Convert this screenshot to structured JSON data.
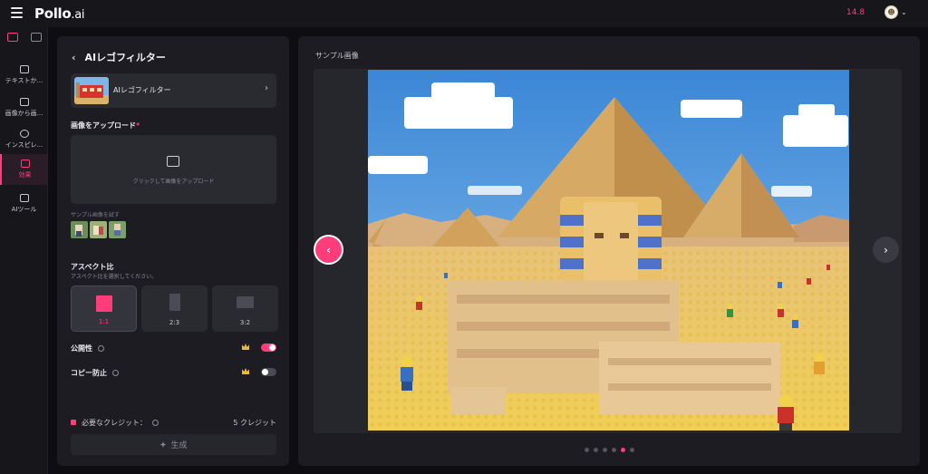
{
  "app": {
    "logo_main": "Pollo",
    "logo_suffix": ".ai",
    "credits": "14.8"
  },
  "rail": {
    "items": [
      {
        "label": "テキストか..."
      },
      {
        "label": "画像から画..."
      },
      {
        "label": "インスピレ..."
      },
      {
        "label": "効果"
      },
      {
        "label": "AIツール"
      }
    ]
  },
  "panel": {
    "title": "AIレゴフィルター",
    "filter_name": "AIレゴフィルター",
    "upload_label": "画像をアップロード",
    "required_mark": "*",
    "upload_hint": "クリックして画像をアップロード",
    "sample_label": "サンプル画像を試す",
    "aspect_title": "アスペクト比",
    "aspect_subtitle": "アスペクト比を選択してください。",
    "aspect_options": [
      {
        "label": "1:1"
      },
      {
        "label": "2:3"
      },
      {
        "label": "3:2"
      }
    ],
    "public_label": "公開性",
    "copy_label": "コピー防止",
    "public_on": true,
    "copy_on": false,
    "required_credits_label": "必要なクレジット：",
    "required_credits_value": "5 クレジット",
    "generate_label": "生成"
  },
  "viewer": {
    "title": "サンプル画像",
    "dot_count": 6,
    "active_dot": 4
  },
  "colors": {
    "accent": "#ff3d7a",
    "panel_bg": "#1c1c22",
    "page_bg": "#0e0e12"
  }
}
